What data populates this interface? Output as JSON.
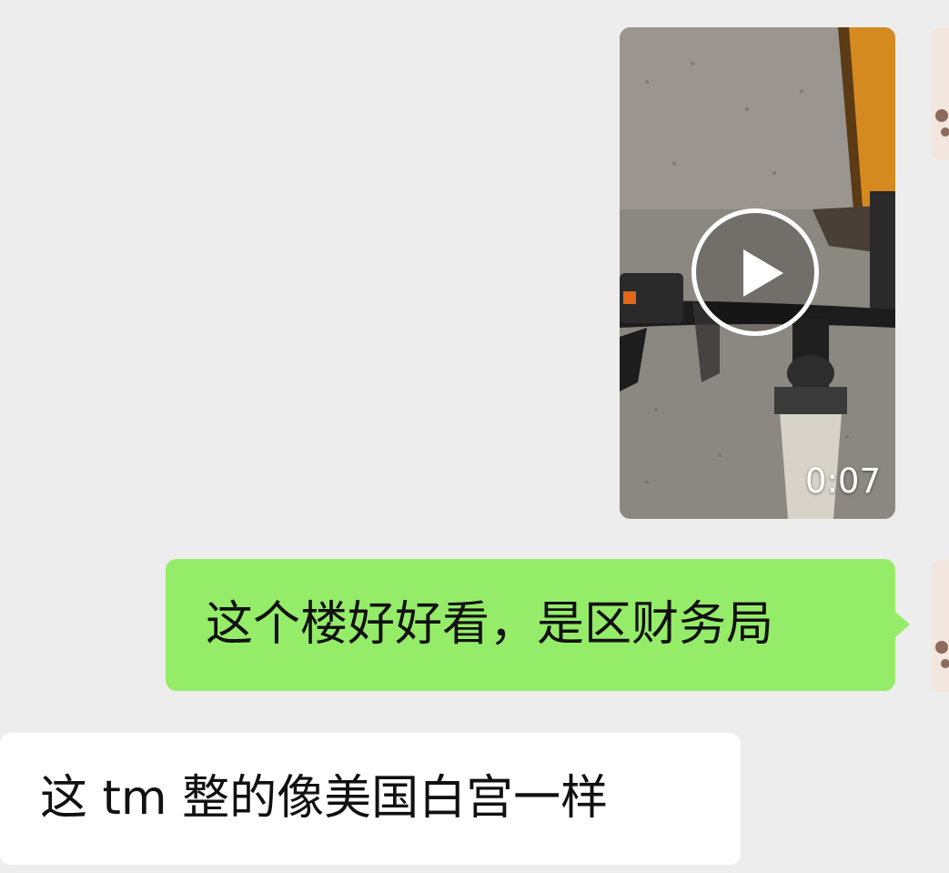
{
  "messages": [
    {
      "type": "video",
      "direction": "sent",
      "duration": "0:07",
      "play_icon": "play-icon"
    },
    {
      "type": "text",
      "direction": "sent",
      "text": "这个楼好好看，是区财务局"
    },
    {
      "type": "text",
      "direction": "received",
      "text": "这 tm 整的像美国白宫一样"
    }
  ],
  "colors": {
    "background": "#ededed",
    "sent_bubble": "#95ec69",
    "received_bubble": "#ffffff",
    "text": "#111111"
  }
}
